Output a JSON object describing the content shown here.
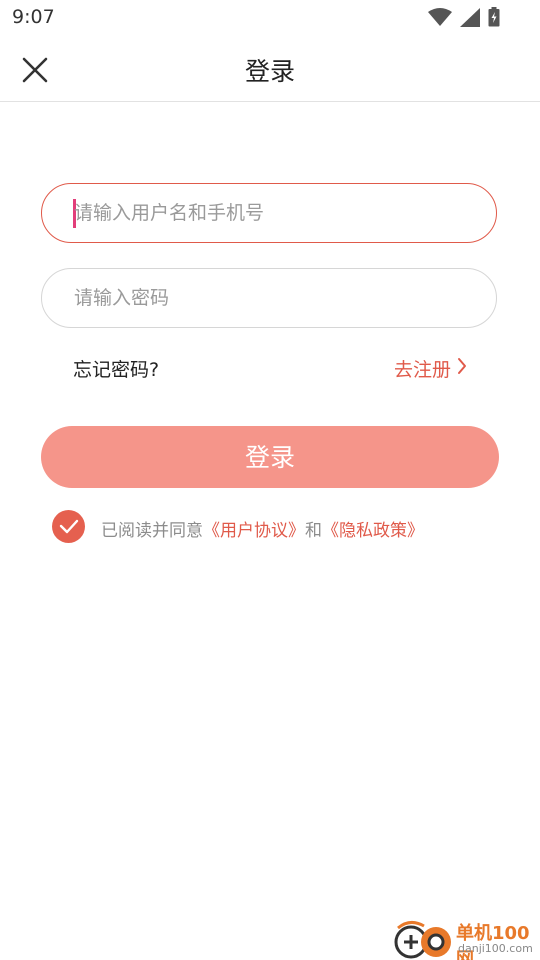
{
  "status_bar": {
    "time": "9:07"
  },
  "header": {
    "title": "登录"
  },
  "form": {
    "username_placeholder": "请输入用户名和手机号",
    "username_value": "",
    "password_placeholder": "请输入密码",
    "password_value": ""
  },
  "links": {
    "forgot": "忘记密码?",
    "register": "去注册"
  },
  "login_button": "登录",
  "agreement": {
    "checked": true,
    "prefix": "已阅读并同意",
    "user_agreement": "《用户协议》",
    "and": "和",
    "privacy_policy": "《隐私政策》"
  },
  "watermark": {
    "name": "单机100网",
    "url": "danji100.com"
  },
  "colors": {
    "accent": "#e05a4a",
    "button_bg": "#f5958a",
    "checkbox": "#e5604f",
    "caret": "#e23e7a"
  }
}
